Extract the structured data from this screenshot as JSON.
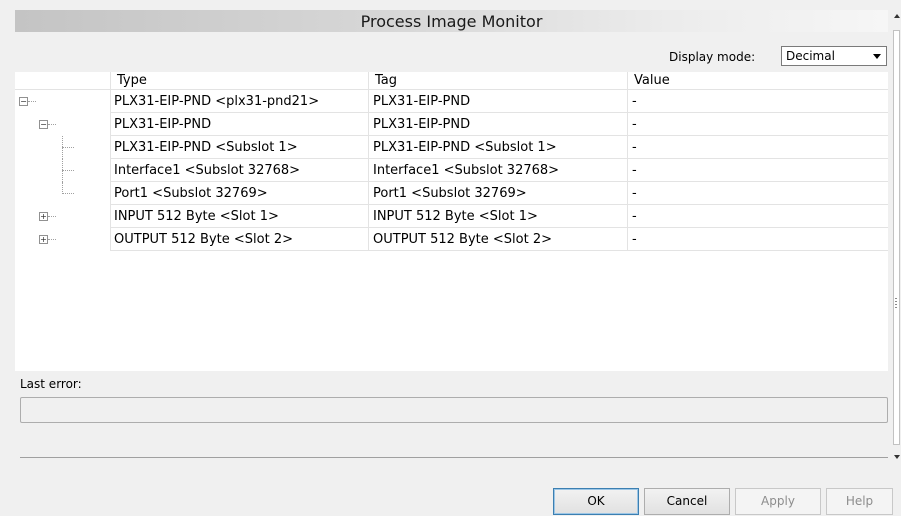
{
  "window": {
    "title": "Process Image Monitor"
  },
  "display_mode": {
    "label": "Display mode:",
    "selected": "Decimal"
  },
  "table": {
    "columns": [
      "Type",
      "Tag",
      "Value"
    ],
    "rows": [
      {
        "type": "PLX31-EIP-PND <plx31-pnd21>",
        "tag": "PLX31-EIP-PND",
        "value": "-",
        "level": 0,
        "toggle": "minus"
      },
      {
        "type": "PLX31-EIP-PND",
        "tag": "PLX31-EIP-PND",
        "value": "-",
        "level": 1,
        "toggle": "minus"
      },
      {
        "type": "PLX31-EIP-PND <Subslot 1>",
        "tag": "PLX31-EIP-PND <Subslot 1>",
        "value": "-",
        "level": 2,
        "toggle": "none"
      },
      {
        "type": "Interface1 <Subslot 32768>",
        "tag": "Interface1 <Subslot 32768>",
        "value": "-",
        "level": 2,
        "toggle": "none"
      },
      {
        "type": "Port1 <Subslot 32769>",
        "tag": "Port1 <Subslot 32769>",
        "value": "-",
        "level": 2,
        "toggle": "none"
      },
      {
        "type": "INPUT 512 Byte <Slot 1>",
        "tag": "INPUT 512 Byte <Slot 1>",
        "value": "-",
        "level": 1,
        "toggle": "plus"
      },
      {
        "type": "OUTPUT 512 Byte <Slot 2>",
        "tag": "OUTPUT 512 Byte <Slot 2>",
        "value": "-",
        "level": 1,
        "toggle": "plus"
      }
    ]
  },
  "last_error": {
    "label": "Last error:",
    "value": ""
  },
  "buttons": {
    "ok": "OK",
    "cancel": "Cancel",
    "apply": "Apply",
    "help": "Help"
  }
}
